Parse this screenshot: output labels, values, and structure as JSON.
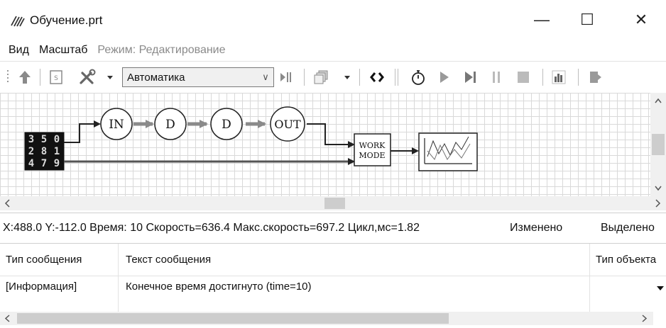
{
  "window": {
    "title": "Обучение.prt",
    "app_icon": "pattern-app-icon",
    "controls": {
      "minimize": "—",
      "maximize": "☐",
      "close": "✕"
    }
  },
  "menu": {
    "items": [
      {
        "label": "Вид",
        "enabled": true
      },
      {
        "label": "Масштаб",
        "enabled": true
      },
      {
        "label": "Режим: Редактирование",
        "enabled": false
      }
    ]
  },
  "toolbar": {
    "mode_select": {
      "value": "Автоматика"
    },
    "icons": [
      "arrow-up-icon",
      "script-icon",
      "tools-icon",
      "dropdown-arrow-icon",
      "step-icon",
      "layers-icon",
      "dropdown-arrow-icon",
      "link-icon",
      "stopwatch-icon",
      "play-icon",
      "step-forward-icon",
      "pause-icon",
      "stop-icon",
      "bar-chart-icon",
      "exit-icon"
    ]
  },
  "diagram": {
    "blocks": {
      "in": "IN",
      "d1": "D",
      "d2": "D",
      "out": "OUT",
      "work_mode_line1": "WORK",
      "work_mode_line2": "MODE"
    },
    "digit_grid": [
      "3",
      "5",
      "0",
      "2",
      "8",
      "1",
      "4",
      "7",
      "9"
    ]
  },
  "status": {
    "text": "X:488.0  Y:-112.0 Время: 10 Скорость=636.4 Макс.скорость=697.2 Цикл,мс=1.82",
    "changed": "Изменено",
    "selected": "Выделено"
  },
  "messages": {
    "columns": [
      "Тип сообщения",
      "Текст сообщения",
      "Тип объекта"
    ],
    "rows": [
      {
        "type": "[Информация]",
        "text": "Конечное время достигнуто (time=10)",
        "object_type": ""
      }
    ]
  },
  "colors": {
    "grid": "#d9d9d9",
    "scrollbar_track": "#f0f0f0",
    "scrollbar_thumb": "#cdcdcd",
    "disabled_text": "#8a8a8a",
    "connector": "#6a6a6a"
  }
}
